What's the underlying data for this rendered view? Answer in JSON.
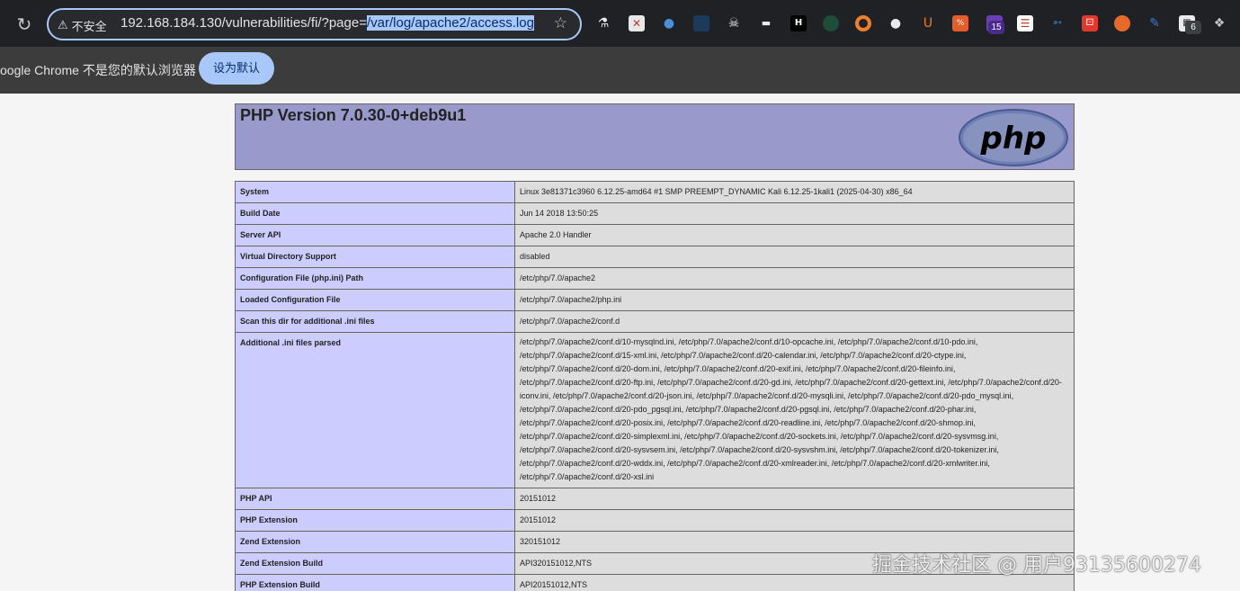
{
  "browser": {
    "security_label": "不安全",
    "url_prefix": "192.168.184.130/vulnerabilities/fi/?page=",
    "url_selected": "/var/log/apache2/access.log",
    "extension_badge_1": "15",
    "extension_badge_2": "6",
    "infobar_text": "oogle Chrome 不是您的默认浏览器",
    "set_default_label": "设为默认"
  },
  "php": {
    "title": "PHP Version 7.0.30-0+deb9u1",
    "logo_text": "php",
    "rows": [
      {
        "key": "System",
        "value": "Linux 3e81371c3960 6.12.25-amd64 #1 SMP PREEMPT_DYNAMIC Kali 6.12.25-1kali1 (2025-04-30) x86_64"
      },
      {
        "key": "Build Date",
        "value": "Jun 14 2018 13:50:25"
      },
      {
        "key": "Server API",
        "value": "Apache 2.0 Handler"
      },
      {
        "key": "Virtual Directory Support",
        "value": "disabled"
      },
      {
        "key": "Configuration File (php.ini) Path",
        "value": "/etc/php/7.0/apache2"
      },
      {
        "key": "Loaded Configuration File",
        "value": "/etc/php/7.0/apache2/php.ini"
      },
      {
        "key": "Scan this dir for additional .ini files",
        "value": "/etc/php/7.0/apache2/conf.d"
      },
      {
        "key": "Additional .ini files parsed",
        "value": "/etc/php/7.0/apache2/conf.d/10-mysqlnd.ini, /etc/php/7.0/apache2/conf.d/10-opcache.ini, /etc/php/7.0/apache2/conf.d/10-pdo.ini, /etc/php/7.0/apache2/conf.d/15-xml.ini, /etc/php/7.0/apache2/conf.d/20-calendar.ini, /etc/php/7.0/apache2/conf.d/20-ctype.ini, /etc/php/7.0/apache2/conf.d/20-dom.ini, /etc/php/7.0/apache2/conf.d/20-exif.ini, /etc/php/7.0/apache2/conf.d/20-fileinfo.ini, /etc/php/7.0/apache2/conf.d/20-ftp.ini, /etc/php/7.0/apache2/conf.d/20-gd.ini, /etc/php/7.0/apache2/conf.d/20-gettext.ini, /etc/php/7.0/apache2/conf.d/20-iconv.ini, /etc/php/7.0/apache2/conf.d/20-json.ini, /etc/php/7.0/apache2/conf.d/20-mysqli.ini, /etc/php/7.0/apache2/conf.d/20-pdo_mysql.ini, /etc/php/7.0/apache2/conf.d/20-pdo_pgsql.ini, /etc/php/7.0/apache2/conf.d/20-pgsql.ini, /etc/php/7.0/apache2/conf.d/20-phar.ini, /etc/php/7.0/apache2/conf.d/20-posix.ini, /etc/php/7.0/apache2/conf.d/20-readline.ini, /etc/php/7.0/apache2/conf.d/20-shmop.ini, /etc/php/7.0/apache2/conf.d/20-simplexml.ini, /etc/php/7.0/apache2/conf.d/20-sockets.ini, /etc/php/7.0/apache2/conf.d/20-sysvmsg.ini, /etc/php/7.0/apache2/conf.d/20-sysvsem.ini, /etc/php/7.0/apache2/conf.d/20-sysvshm.ini, /etc/php/7.0/apache2/conf.d/20-tokenizer.ini, /etc/php/7.0/apache2/conf.d/20-wddx.ini, /etc/php/7.0/apache2/conf.d/20-xmlreader.ini, /etc/php/7.0/apache2/conf.d/20-xmlwriter.ini, /etc/php/7.0/apache2/conf.d/20-xsl.ini"
      },
      {
        "key": "PHP API",
        "value": "20151012"
      },
      {
        "key": "PHP Extension",
        "value": "20151012"
      },
      {
        "key": "Zend Extension",
        "value": "320151012"
      },
      {
        "key": "Zend Extension Build",
        "value": "API320151012,NTS"
      },
      {
        "key": "PHP Extension Build",
        "value": "API20151012,NTS"
      }
    ]
  },
  "watermark": "掘金技术社区 @ 用户9313560027​4"
}
